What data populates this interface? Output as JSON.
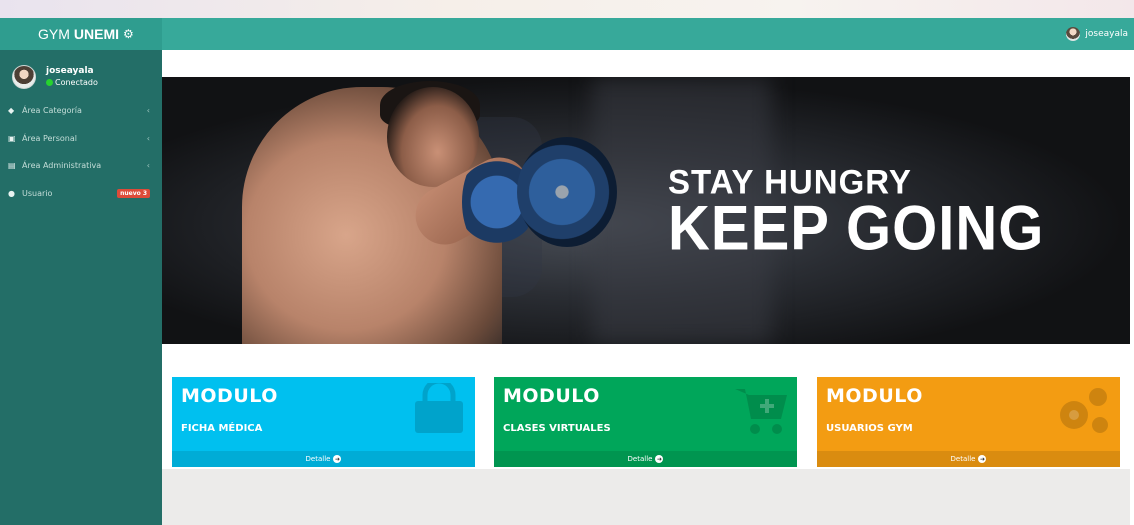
{
  "header": {
    "brand_light": "GYM",
    "brand_bold": "UNEMI",
    "brand_icon": "gears-icon",
    "username": "joseayala"
  },
  "sidebar": {
    "profile": {
      "name": "joseayala",
      "status": "Conectado"
    },
    "items": [
      {
        "label": "Área Categoría",
        "icon": "tags-icon",
        "expandable": true
      },
      {
        "label": "Área Personal",
        "icon": "id-card-icon",
        "expandable": true
      },
      {
        "label": "Área Administrativa",
        "icon": "clipboard-icon",
        "expandable": true
      },
      {
        "label": "Usuario",
        "icon": "user-icon",
        "badge": "nuevo 3"
      }
    ]
  },
  "banner": {
    "line1": "STAY HUNGRY",
    "line2": "KEEP GOING"
  },
  "modules": [
    {
      "title": "MODULO",
      "subtitle": "FICHA MÉDICA",
      "link": "Detalle",
      "color": "#00c0ef",
      "icon": "shopping-bag-icon"
    },
    {
      "title": "MODULO",
      "subtitle": "CLASES VIRTUALES",
      "link": "Detalle",
      "color": "#00a65a",
      "icon": "cart-plus-icon"
    },
    {
      "title": "MODULO",
      "subtitle": "USUARIOS GYM",
      "link": "Detalle",
      "color": "#f39c12",
      "icon": "gears-icon"
    }
  ],
  "colors": {
    "header": "#37a99a",
    "sidebar": "#236e67",
    "online": "#26d22e",
    "badge": "#dd4b39"
  }
}
